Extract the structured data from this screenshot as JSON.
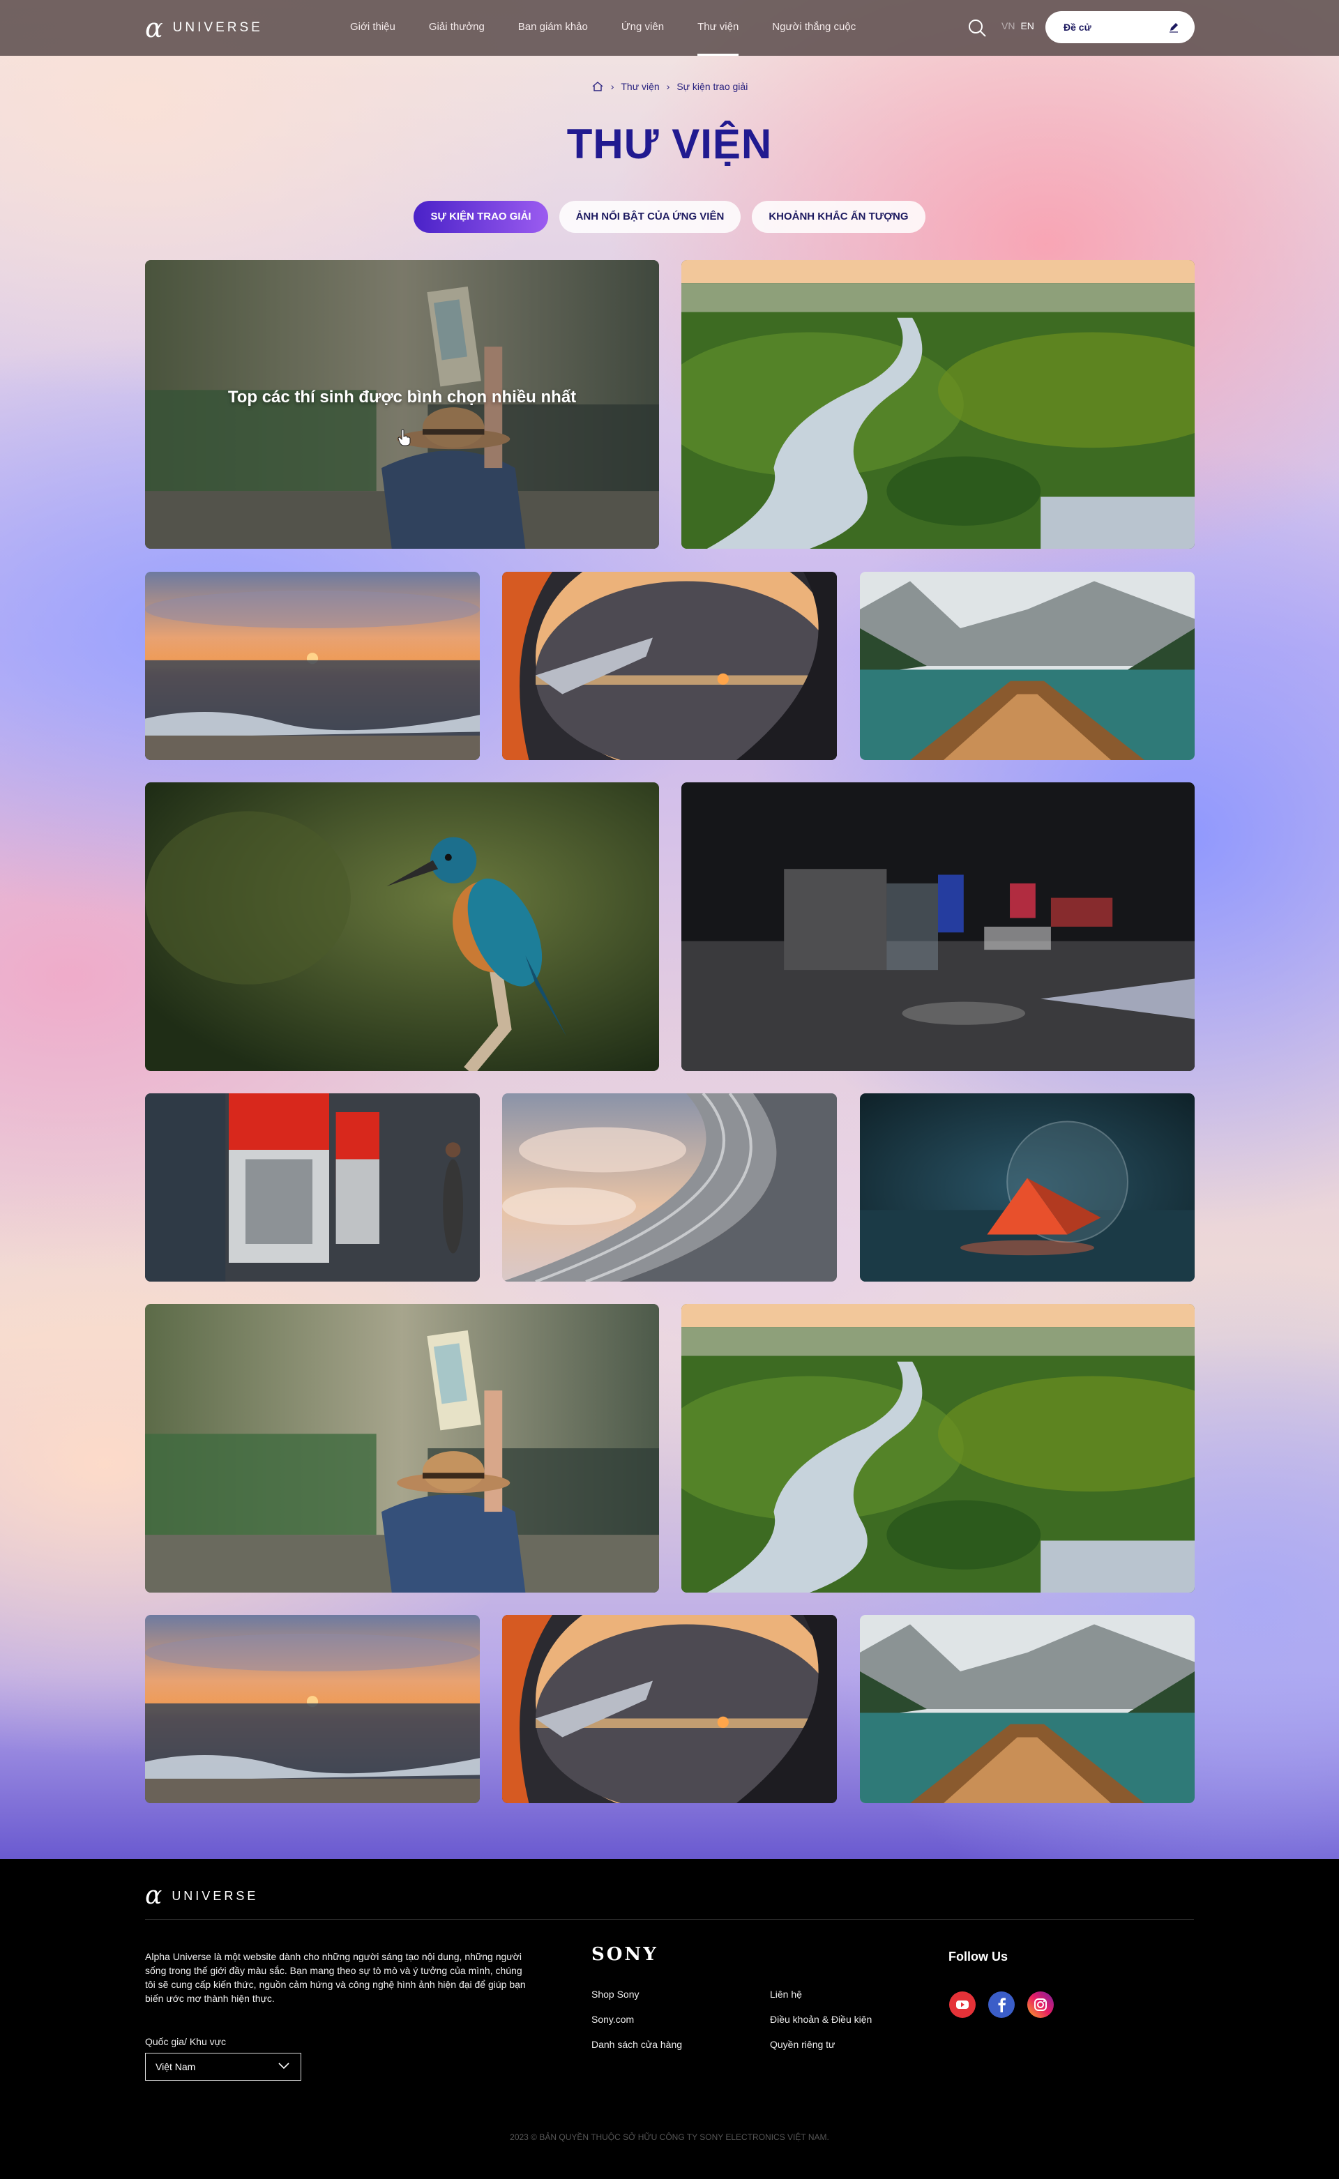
{
  "header": {
    "logo_mark": "α",
    "logo_text": "UNIVERSE",
    "nav": [
      "Giới thiệu",
      "Giải thưởng",
      "Ban giám khảo",
      "Ứng viên",
      "Thư viện",
      "Người thắng cuộc"
    ],
    "active_nav": "Thư viện",
    "lang_vn": "VN",
    "lang_en": "EN",
    "nominate_label": "Đề cử"
  },
  "breadcrumb": {
    "home_icon": "home-icon",
    "items": [
      "Thư viện",
      "Sự kiện trao giải"
    ]
  },
  "page_title": "THƯ VIỆN",
  "tabs": [
    "SỰ KIỆN TRAO GIẢI",
    "ẢNH NỔI BẬT CỦA ỨNG VIÊN",
    "KHOẢNH KHẮC ẤN TƯỢNG"
  ],
  "active_tab": "SỰ KIỆN TRAO GIẢI",
  "gallery": {
    "hover_caption": "Top các thí sinh được bình chọn nhiều nhất",
    "photos": [
      "woman-with-map",
      "river-forest-aerial",
      "sea-sunset",
      "airplane-window",
      "lake-boat-mountains",
      "kingfisher",
      "dark-exhibition-hall",
      "red-wall-architecture",
      "sky-curved-building",
      "crystal-ball-prism",
      "woman-with-map",
      "river-forest-aerial",
      "sea-sunset",
      "airplane-window",
      "lake-boat-mountains"
    ]
  },
  "footer": {
    "logo_mark": "α",
    "logo_text": "UNIVERSE",
    "about": "Alpha Universe là một website dành cho những người sáng tạo nội dung, những người sống trong thế giới đầy màu sắc. Bạn mang theo sự tò mò và ý tưởng của mình, chúng tôi sẽ cung cấp kiến thức, nguồn cảm hứng và công nghệ hình ảnh hiện đại để giúp bạn biến ước mơ thành hiện thực.",
    "region_label": "Quốc gia/ Khu vực",
    "region_value": "Việt Nam",
    "brand": "SONY",
    "links_col1": [
      "Shop Sony",
      "Sony.com",
      "Danh sách cửa hàng"
    ],
    "links_col2": [
      "Liên hệ",
      "Điều khoản & Điều kiện",
      "Quyền riêng tư"
    ],
    "follow_title": "Follow Us",
    "social": [
      "youtube-icon",
      "facebook-icon",
      "instagram-icon"
    ],
    "copyright": "2023 © BẢN QUYỀN THUỘC SỞ HỮU CÔNG TY SONY ELECTRONICS VIỆT NAM."
  },
  "colors": {
    "accent": "#211a90",
    "tab_active_start": "#4a22c8",
    "tab_active_end": "#9b5cf0"
  }
}
